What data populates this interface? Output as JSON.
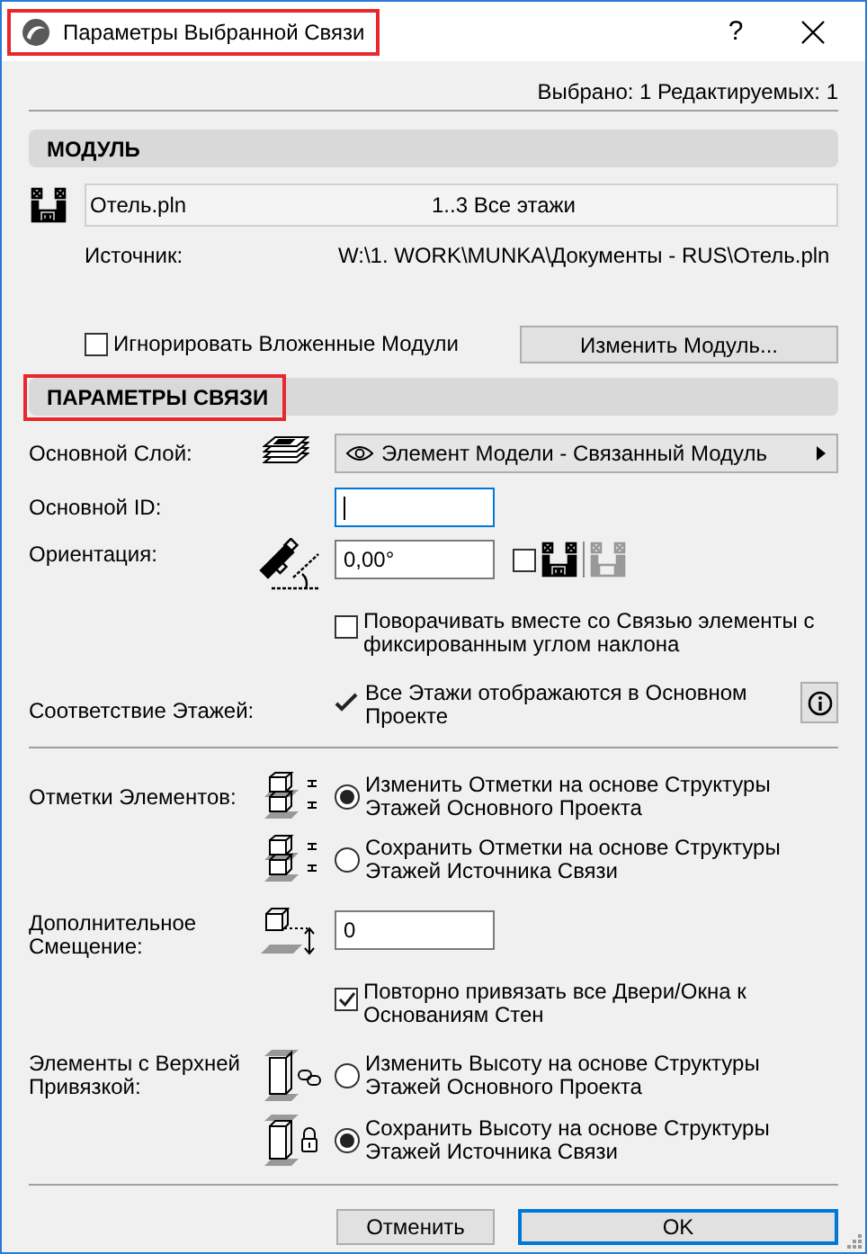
{
  "window": {
    "title": "Параметры Выбранной Связи",
    "highlighted": true,
    "help": "?"
  },
  "selection_info": "Выбрано: 1 Редактируемых: 1",
  "module_section": {
    "title": "МОДУЛЬ",
    "highlighted": false,
    "file": "Отель.pln",
    "stories": "1..3 Все этажи",
    "source_label": "Источник:",
    "source_path": "W:\\1. WORK\\MUNKA\\Документы - RUS\\Отель.pln",
    "ignore_nested": {
      "label": "Игнорировать Вложенные Модули",
      "checked": false
    },
    "change_button": "Изменить Модуль..."
  },
  "link_section": {
    "title": "ПАРАМЕТРЫ СВЯЗИ",
    "highlighted": true,
    "layer": {
      "label": "Основной Слой:",
      "value": "Элемент Модели - Связанный Модуль"
    },
    "master_id": {
      "label": "Основной ID:",
      "focused": true
    },
    "orientation": {
      "label": "Ориентация:",
      "value": "0,00°",
      "mirror_checked": false
    },
    "rotate_fixed": {
      "label": "Поворачивать вместе со Связью элементы с фиксированным углом наклона",
      "checked": false
    },
    "story_match": {
      "label": "Соответствие Этажей:",
      "status": "Все Этажи отображаются в Основном Проекте",
      "ok": true
    }
  },
  "elevations": {
    "label": "Отметки Элементов:",
    "options": [
      {
        "label": "Изменить Отметки на основе Структуры Этажей Основного Проекта",
        "selected": true
      },
      {
        "label": "Сохранить Отметки на основе Структуры Этажей Источника Связи",
        "selected": false
      }
    ]
  },
  "offset": {
    "label": "Дополнительное Смещение:",
    "value": "0"
  },
  "realign": {
    "label": "Повторно привязать все Двери/Окна к Основаниям Стен",
    "checked": true
  },
  "top_linked": {
    "label": "Элементы с Верхней Привязкой:",
    "options": [
      {
        "label": "Изменить Высоту на основе Структуры Этажей Основного Проекта",
        "selected": false
      },
      {
        "label": "Сохранить Высоту на основе Структуры Этажей Источника Связи",
        "selected": true
      }
    ]
  },
  "footer_buttons": [
    {
      "label": "Отменить",
      "default": false
    },
    {
      "label": "OK",
      "default": true
    }
  ]
}
